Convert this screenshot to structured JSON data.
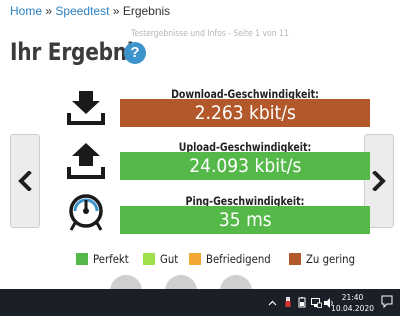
{
  "breadcrumb": {
    "home": "Home",
    "speedtest": "Speedtest",
    "current": "Ergebnis",
    "separator": "»"
  },
  "subinfo": "Testergebnisse und Infos - Seite 1 von 11",
  "title": "Ihr Ergebnis",
  "help_label": "?",
  "results": [
    {
      "label": "Download-Geschwindigkeit:",
      "value": "2.263 kbit/s",
      "rating": "Zu gering",
      "color": "#b2582a",
      "icon": "download-icon"
    },
    {
      "label": "Upload-Geschwindigkeit:",
      "value": "24.093 kbit/s",
      "rating": "Perfekt",
      "color": "#55b94a",
      "icon": "upload-icon"
    },
    {
      "label": "Ping-Geschwindigkeit:",
      "value": "35 ms",
      "rating": "Perfekt",
      "color": "#55b94a",
      "icon": "ping-gauge-icon"
    }
  ],
  "legend": [
    {
      "label": "Perfekt",
      "color": "#55b94a"
    },
    {
      "label": "Gut",
      "color": "#9fe04a"
    },
    {
      "label": "Befriedigend",
      "color": "#f0a832"
    },
    {
      "label": "Zu gering",
      "color": "#b2582a"
    }
  ],
  "nav": {
    "prev_icon": "chevron-left-icon",
    "next_icon": "chevron-right-icon"
  },
  "taskbar": {
    "time": "21:40",
    "date": "10.04.2020",
    "tray_icons": [
      "chevron-up-icon",
      "usb-icon",
      "battery-icon",
      "network-icon",
      "volume-icon",
      "notification-icon"
    ]
  }
}
